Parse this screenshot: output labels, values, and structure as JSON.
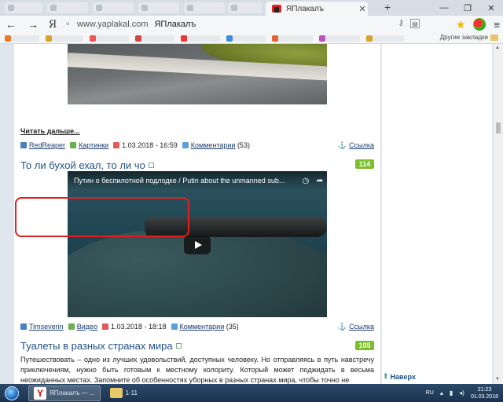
{
  "browser": {
    "active_tab_title": "ЯПлакалъ",
    "new_tab": "+",
    "window_controls": {
      "minimize": "—",
      "maximize": "❐",
      "close": "✕"
    },
    "nav": {
      "back": "←",
      "forward": "→",
      "yandex": "Я"
    },
    "url_host": "www.yaplakal.com",
    "url_title": "ЯПлакалъ",
    "other_bookmarks": "Другие закладки"
  },
  "page": {
    "read_more": "Читать дальше...",
    "posts": [
      {
        "author": "RedReaper",
        "category": "Картинки",
        "date": "1.03.2018 - 16:59",
        "comments_label": "Комментарии",
        "comments_count": "(53)",
        "link_label": "Ссылка"
      },
      {
        "title": "То ли бухой ехал, то ли чо",
        "score": "114",
        "video_title": "Путин о беспилотной подлодке / Putin about the unmanned sub...",
        "author": "Timseverin",
        "category": "Видео",
        "date": "1.03.2018 - 18:18",
        "comments_label": "Комментарии",
        "comments_count": "(35)",
        "link_label": "Ссылка"
      },
      {
        "title": "Туалеты в разных странах мира",
        "score": "105",
        "excerpt": "Путешествовать – одно из лучших удовольствий, доступных человеку. Но отправляясь в путь навстречу приключениям, нужно быть готовым к местному колориту. Который может поджидать в весьма неожиданных местах. Запомните об особенностях уборных в разных странах мира, чтобы точно не"
      }
    ],
    "back_to_top": "Наверх"
  },
  "taskbar": {
    "tasks": [
      {
        "label": "ЯПлакалъ — ..."
      },
      {
        "label": "1-11"
      }
    ],
    "lang": "RU",
    "time": "21:23",
    "date": "01.03.2018"
  }
}
